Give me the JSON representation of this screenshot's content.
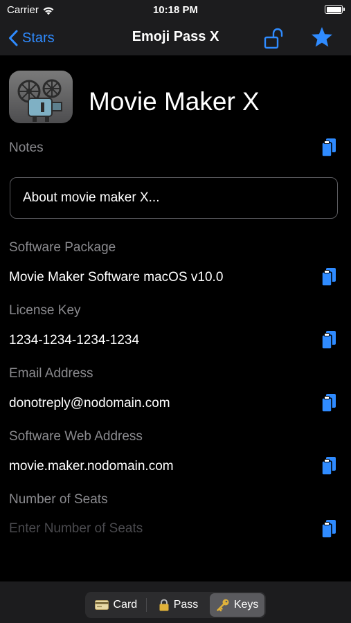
{
  "status_bar": {
    "carrier": "Carrier",
    "time": "10:18 PM"
  },
  "nav": {
    "back_label": "Stars",
    "title": "Emoji Pass X"
  },
  "header": {
    "app_name": "Movie Maker X"
  },
  "notes": {
    "label": "Notes",
    "value": "About movie maker X..."
  },
  "fields": [
    {
      "label": "Software Package",
      "value": "Movie Maker Software macOS v10.0"
    },
    {
      "label": "License Key",
      "value": "1234-1234-1234-1234"
    },
    {
      "label": "Email Address",
      "value": "donotreply@nodomain.com"
    },
    {
      "label": "Software Web Address",
      "value": "movie.maker.nodomain.com"
    },
    {
      "label": "Number of Seats",
      "placeholder": "Enter Number of Seats"
    }
  ],
  "toolbar": {
    "segments": [
      {
        "label": "Card",
        "icon": "credit-card-icon"
      },
      {
        "label": "Pass",
        "icon": "lock-icon"
      },
      {
        "label": "Keys",
        "icon": "key-icon"
      }
    ],
    "selected": "Keys"
  },
  "colors": {
    "accent": "#2f8bff",
    "background": "#000000",
    "bar": "#1c1c1e",
    "label": "#8a8a8e"
  }
}
